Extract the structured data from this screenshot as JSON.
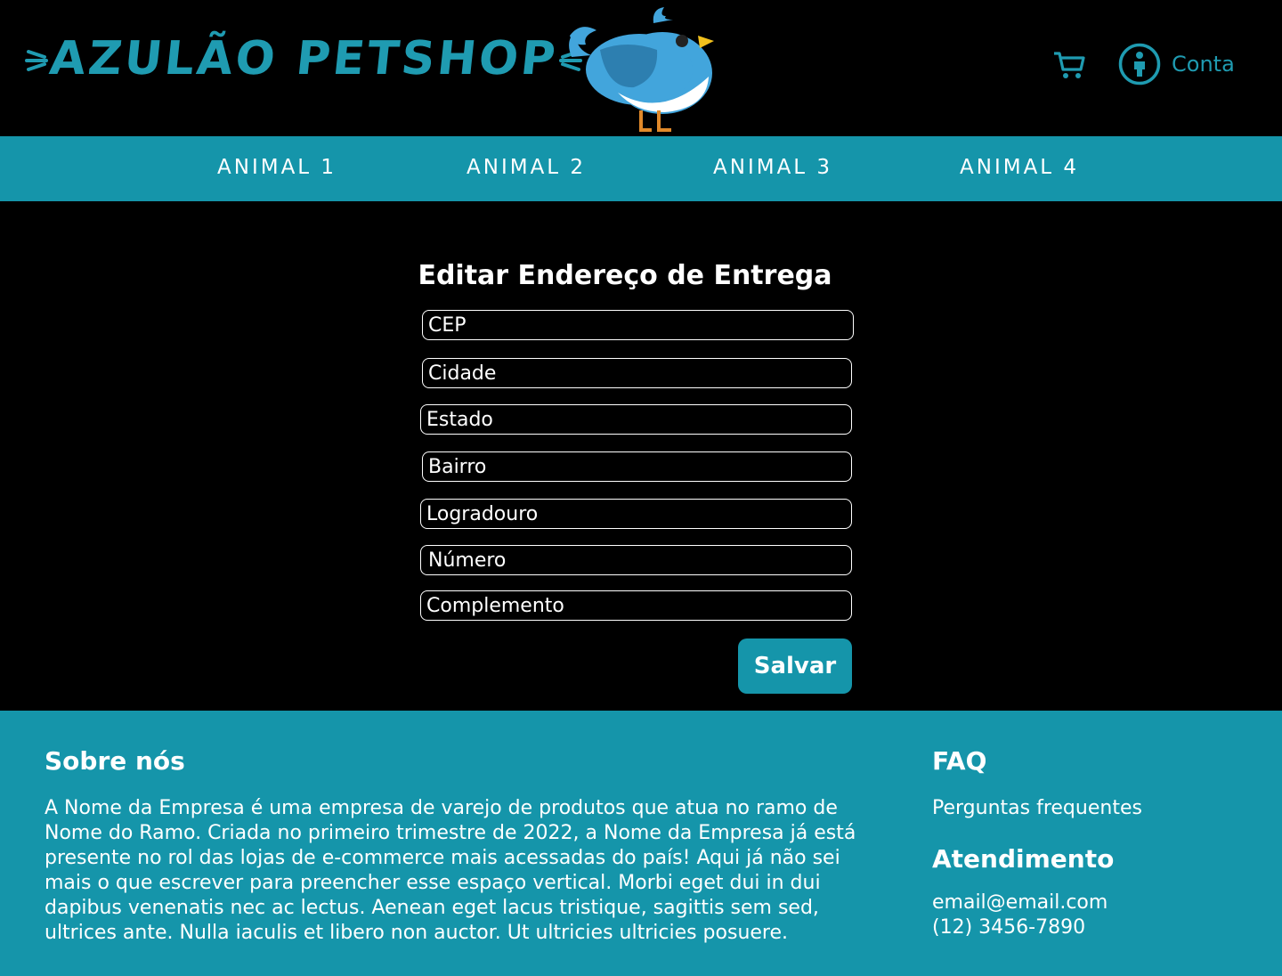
{
  "header": {
    "brand": "AZULÃO PETSHOP",
    "cart_icon": "cart-icon",
    "account_icon": "person-circle-icon",
    "account_label": "Conta",
    "accent_color": "#1f9bb1"
  },
  "nav": {
    "items": [
      {
        "label": "ANIMAL 1"
      },
      {
        "label": "ANIMAL 2"
      },
      {
        "label": "ANIMAL 3"
      },
      {
        "label": "ANIMAL 4"
      }
    ],
    "bg_color": "#1595aa"
  },
  "form": {
    "title": "Editar Endereço de Entrega",
    "fields": [
      {
        "placeholder": "CEP"
      },
      {
        "placeholder": "Cidade"
      },
      {
        "placeholder": "Estado"
      },
      {
        "placeholder": "Bairro"
      },
      {
        "placeholder": "Logradouro"
      },
      {
        "placeholder": "Número"
      },
      {
        "placeholder": "Complemento"
      }
    ],
    "save_label": "Salvar"
  },
  "footer": {
    "about_title": "Sobre nós",
    "about_text": "A Nome da Empresa é uma empresa de varejo de produtos que atua no ramo de Nome do Ramo. Criada no primeiro trimestre de 2022, a Nome da Empresa já está presente no rol das  lojas de e-commerce mais acessadas do país! Aqui já não sei mais o que escrever para preencher esse espaço vertical. Morbi eget dui in dui dapibus venenatis nec ac lectus. Aenean eget lacus tristique, sagittis sem sed, ultrices ante. Nulla iaculis et libero non auctor. Ut ultricies ultricies posuere.",
    "faq_title": "FAQ",
    "faq_link": "Perguntas frequentes",
    "support_title": "Atendimento",
    "email": "email@email.com",
    "phone": "(12) 3456-7890"
  }
}
